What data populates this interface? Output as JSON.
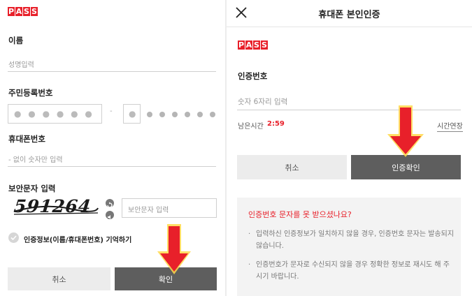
{
  "left": {
    "logo": [
      "P",
      "A",
      "S",
      "S"
    ],
    "name": {
      "label": "이름",
      "placeholder": "성명입력"
    },
    "rrn": {
      "label": "주민등록번호",
      "front_mask": "● ● ● ● ● ●",
      "dash": "-",
      "back_first": "●"
    },
    "phone": {
      "label": "휴대폰번호",
      "placeholder": "- 없이 숫자만 입력"
    },
    "captcha": {
      "label": "보안문자 입력",
      "code": "591264",
      "placeholder": "보안문자 입력"
    },
    "remember": {
      "label": "인증정보(이름/휴대폰번호) 기억하기"
    },
    "buttons": {
      "cancel": "취소",
      "confirm": "확인"
    }
  },
  "right": {
    "title": "휴대폰 본인인증",
    "logo": [
      "P",
      "A",
      "S",
      "S"
    ],
    "code": {
      "label": "인증번호",
      "placeholder": "숫자 6자리 입력"
    },
    "timer": {
      "label": "남은시간",
      "value": "2:59",
      "extend": "시간연장"
    },
    "buttons": {
      "cancel": "취소",
      "confirm": "인증확인"
    },
    "help": {
      "title": "인증번호 문자를 못 받으셨나요?",
      "items": [
        "입력하신 인증정보가 일치하지 않을 경우, 인증번호 문자는 발송되지 않습니다.",
        "인증번호가 문자로 수신되지 않을 경우 정확한 정보로 재시도 해 주시기 바랍니다."
      ]
    }
  },
  "colors": {
    "brand": "#e8202a",
    "arrow": "#e8202a",
    "arrow_glow": "#ffd84a",
    "dark_button": "#5e5e5e"
  },
  "icons": [
    "close-icon",
    "refresh-icon",
    "audio-icon",
    "check-icon",
    "down-arrow-icon"
  ]
}
